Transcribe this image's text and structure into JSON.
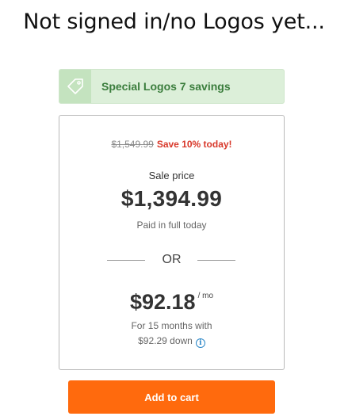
{
  "caption": "Not signed in/no Logos yet...",
  "promo": {
    "icon": "tag-icon",
    "text": "Special Logos 7 savings"
  },
  "pricing": {
    "original_price": "$1,549.99",
    "save_text": "Save 10% today!",
    "sale_label": "Sale price",
    "sale_price": "$1,394.99",
    "paid_note": "Paid in full today",
    "or_label": "OR",
    "monthly_price": "$92.18",
    "per_month": "/ mo",
    "term_line1": "For 15 months with",
    "term_line2": "$92.29 down",
    "info_icon": "info-icon"
  },
  "cart": {
    "button_label": "Add to cart"
  },
  "colors": {
    "promo_bg": "#dcefd9",
    "promo_text": "#3a7d3c",
    "save_red": "#d8382a",
    "cart_orange": "#ff6a0d",
    "info_blue": "#2a86c7"
  }
}
